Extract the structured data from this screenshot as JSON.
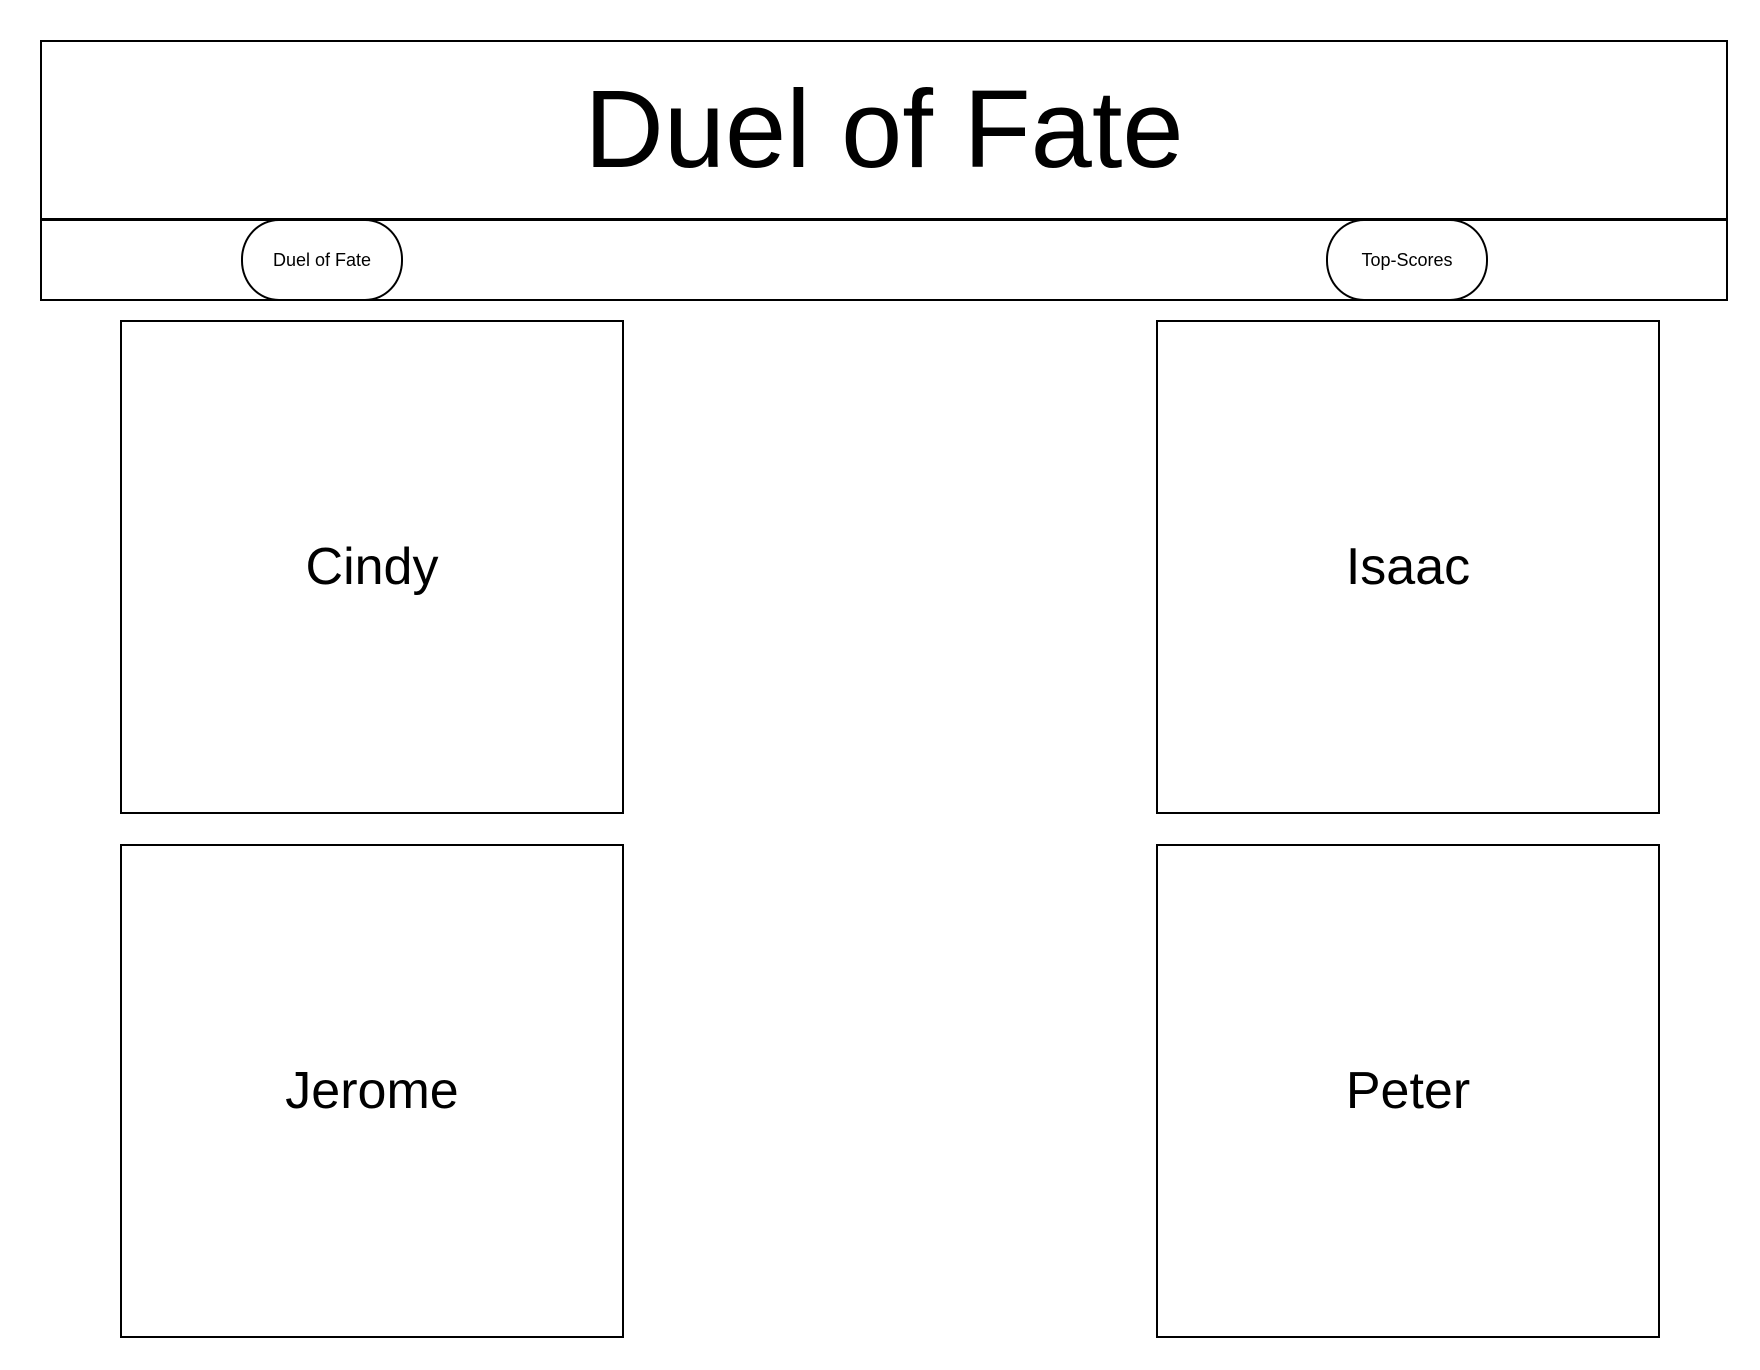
{
  "header": {
    "title": "Duel of Fate"
  },
  "nav": {
    "items": [
      {
        "label": "Duel of Fate"
      },
      {
        "label": "Top-Scores"
      }
    ]
  },
  "players": [
    {
      "name": "Cindy"
    },
    {
      "name": "Isaac"
    },
    {
      "name": "Jerome"
    },
    {
      "name": "Peter"
    }
  ]
}
